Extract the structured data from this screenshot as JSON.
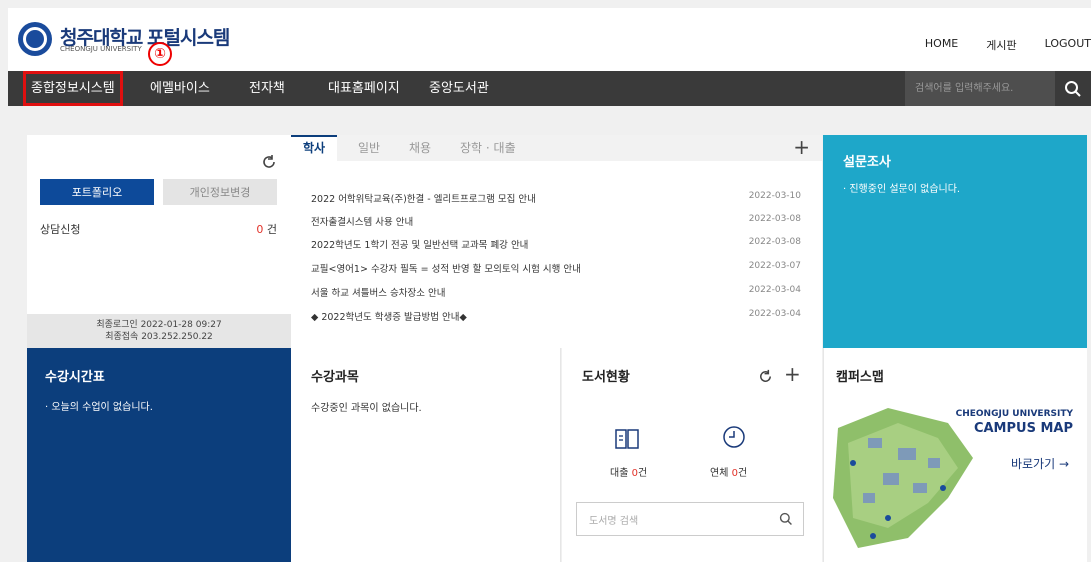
{
  "header": {
    "university_name": "청주대학교",
    "university_sub": "CHEONGJU UNIVERSITY",
    "portal_title": "포털시스템",
    "marker_label": "①",
    "links": [
      "HOME",
      "게시판",
      "LOGOUT"
    ]
  },
  "nav": {
    "items": [
      "종합정보시스템",
      "에멜바이스",
      "전자책",
      "대표홈페이지",
      "중앙도서관"
    ],
    "search_placeholder": "검색어를 입력해주세요."
  },
  "profile": {
    "portfolio_label": "포트폴리오",
    "privacy_label": "개인정보변경",
    "consult_label": "상담신청",
    "consult_count": "0",
    "consult_unit": "건",
    "last_login": "최종로그인 2022-01-28 09:27",
    "last_access": "최종접속 203.252.250.22"
  },
  "notices": {
    "tabs": [
      "학사",
      "일반",
      "채용",
      "장학 · 대출"
    ],
    "items": [
      {
        "title": "2022 어학위탁교육(주)한결 - 엘리트프로그램 모집 안내",
        "date": "2022-03-10"
      },
      {
        "title": "전자출결시스템 사용 안내",
        "date": "2022-03-08"
      },
      {
        "title": "2022학년도 1학기 전공 및 일반선택 교과목 폐강 안내",
        "date": "2022-03-08"
      },
      {
        "title": "교필<영어1> 수강자 필독 = 성적 반영 할 모의토익 시험 시행 안내",
        "date": "2022-03-07"
      },
      {
        "title": "서울 하교 셔틀버스 승차장소 안내",
        "date": "2022-03-04"
      },
      {
        "title": "◆ 2022학년도 학생증 발급방법 안내◆",
        "date": "2022-03-04"
      }
    ]
  },
  "survey": {
    "title": "설문조사",
    "text": "· 진행중인 설문이 없습니다."
  },
  "timetable": {
    "title": "수강시간표",
    "text": "· 오늘의 수업이 없습니다."
  },
  "courses": {
    "title": "수강과목",
    "text": "수강중인 과목이 없습니다."
  },
  "library": {
    "title": "도서현황",
    "loan_label": "대출",
    "loan_count": "0",
    "overdue_label": "연체",
    "overdue_count": "0",
    "unit": "건",
    "search_placeholder": "도서명 검색"
  },
  "campus": {
    "title": "캠퍼스맵",
    "name_line1": "CHEONGJU UNIVERSITY",
    "name_line2": "CAMPUS MAP",
    "link": "바로가기 →"
  },
  "colors": {
    "nav_bg": "#3a3a3a",
    "brand_blue": "#0c3e7c",
    "survey_bg": "#1ea7c9",
    "highlight_red": "#e01010"
  }
}
